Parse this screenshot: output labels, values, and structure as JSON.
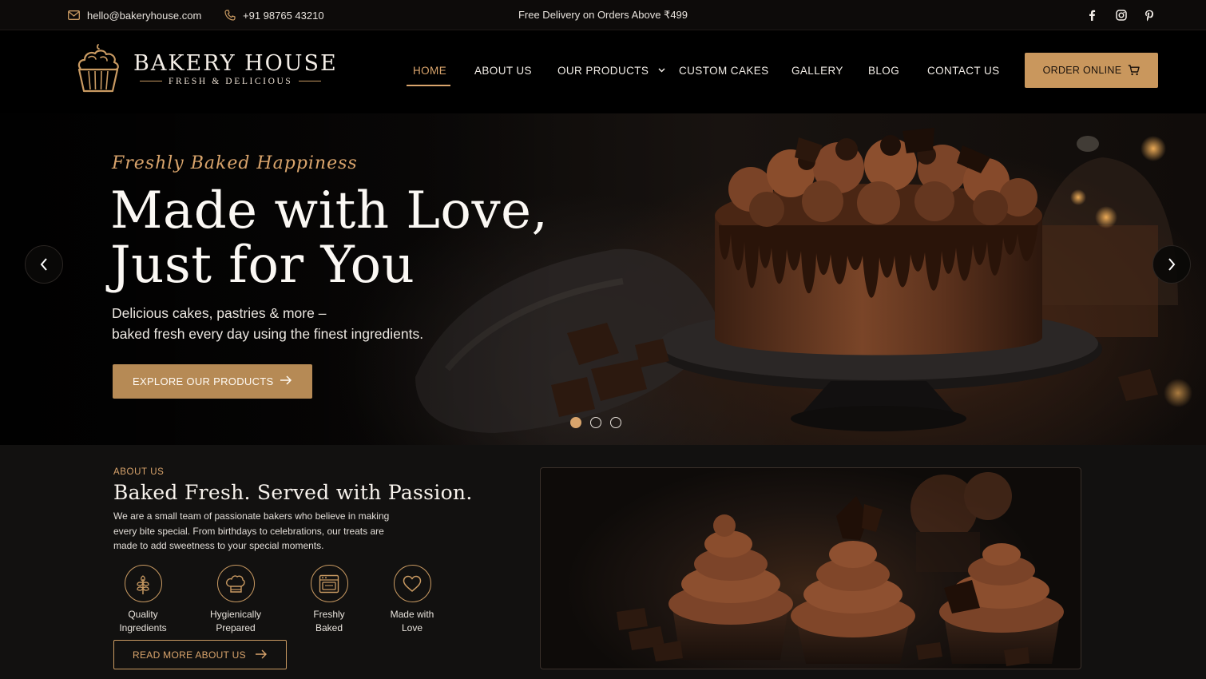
{
  "topbar": {
    "email": "hello@bakeryhouse.com",
    "phone": "+91 98765 43210",
    "promo": "Free Delivery on Orders Above ₹499",
    "social": [
      "facebook-icon",
      "instagram-icon",
      "pinterest-icon"
    ]
  },
  "brand": {
    "name": "BAKERY HOUSE",
    "tagline": "FRESH & DELICIOUS",
    "logo_icon": "cupcake-icon"
  },
  "nav": {
    "items": [
      {
        "label": "HOME",
        "active": true
      },
      {
        "label": "ABOUT US",
        "active": false
      },
      {
        "label": "OUR PRODUCTS",
        "active": false,
        "has_dropdown": true
      },
      {
        "label": "CUSTOM CAKES",
        "active": false
      },
      {
        "label": "GALLERY",
        "active": false
      },
      {
        "label": "BLOG",
        "active": false
      },
      {
        "label": "CONTACT US",
        "active": false
      }
    ],
    "order_button": "ORDER ONLINE"
  },
  "hero": {
    "tagline": "Freshly Baked Happiness",
    "headline_line1": "Made with Love,",
    "headline_line2": "Just for You",
    "subtext_line1": "Delicious cakes, pastries & more –",
    "subtext_line2": "baked fresh every day using the finest ingredients.",
    "cta": "EXPLORE OUR PRODUCTS",
    "slides_total": 3,
    "slide_active": 1
  },
  "about": {
    "label": "ABOUT US",
    "title": "Baked Fresh. Served with Passion.",
    "body": "We are a small team of passionate bakers who believe in making every bite special. From birthdays to celebrations, our treats are made to add sweetness to your special moments.",
    "features": [
      {
        "icon": "wheat-icon",
        "line1": "Quality",
        "line2": "Ingredients"
      },
      {
        "icon": "chef-hat-icon",
        "line1": "Hygienically",
        "line2": "Prepared"
      },
      {
        "icon": "oven-icon",
        "line1": "Freshly",
        "line2": "Baked"
      },
      {
        "icon": "heart-icon",
        "line1": "Made with",
        "line2": "Love"
      }
    ],
    "cta": "READ MORE ABOUT US"
  },
  "colors": {
    "accent": "#d9a46c",
    "button": "#c9975d",
    "background": "#0c0a09"
  }
}
